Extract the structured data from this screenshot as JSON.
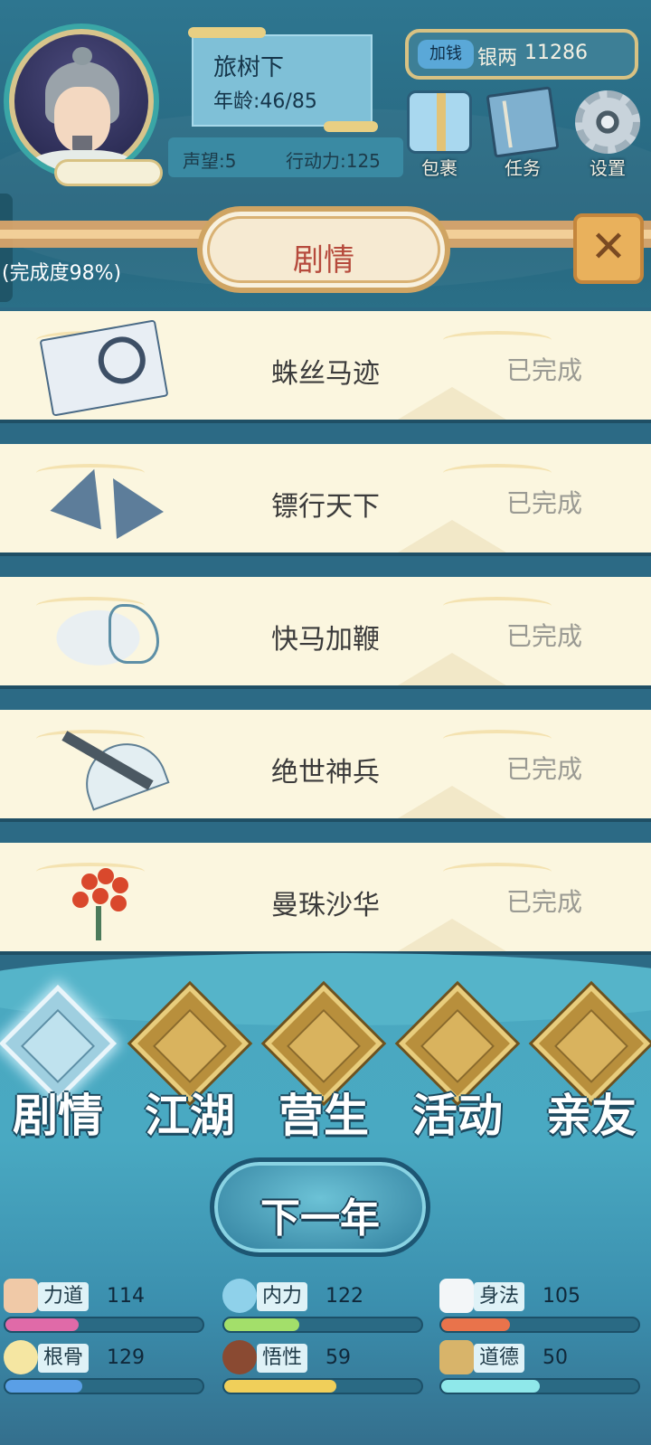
{
  "player": {
    "name": "旅树下",
    "age": "年龄:46/85",
    "reputation": "声望:5",
    "action_points": "行动力:125"
  },
  "money": {
    "add_button": "加钱",
    "label": "银两",
    "amount": "11286"
  },
  "top_buttons": {
    "bag": "包裹",
    "quest": "任务",
    "settings": "设置"
  },
  "panel": {
    "title": "剧情",
    "completion": "(完成度98%)",
    "close_symbol": "✕"
  },
  "story_items": [
    {
      "title": "蛛丝马迹",
      "status": "已完成",
      "icon": "letter-magnifier-icon"
    },
    {
      "title": "镖行天下",
      "status": "已完成",
      "icon": "shuriken-icon"
    },
    {
      "title": "快马加鞭",
      "status": "已完成",
      "icon": "horse-icon"
    },
    {
      "title": "绝世神兵",
      "status": "已完成",
      "icon": "sword-fan-icon"
    },
    {
      "title": "曼珠沙华",
      "status": "已完成",
      "icon": "red-spider-lily-icon"
    }
  ],
  "nav_tabs": [
    {
      "label": "剧情",
      "icon": "story-icon",
      "active": true
    },
    {
      "label": "江湖",
      "icon": "jianghu-hat-icon",
      "active": false
    },
    {
      "label": "营生",
      "icon": "abacus-icon",
      "active": false
    },
    {
      "label": "活动",
      "icon": "scroll-icon",
      "active": false
    },
    {
      "label": "亲友",
      "icon": "friends-icon",
      "active": false
    }
  ],
  "next_year_button": "下一年",
  "attributes": [
    {
      "name": "力道",
      "value": "114",
      "icon": "arm-strength-icon",
      "color": "#e06aa8",
      "fill": 0.37
    },
    {
      "name": "内力",
      "value": "122",
      "icon": "inner-energy-icon",
      "color": "#a3df6a",
      "fill": 0.38
    },
    {
      "name": "身法",
      "value": "105",
      "icon": "swallow-agility-icon",
      "color": "#e9734b",
      "fill": 0.35
    },
    {
      "name": "根骨",
      "value": "129",
      "icon": "root-bone-icon",
      "color": "#5a9fe6",
      "fill": 0.39
    },
    {
      "name": "悟性",
      "value": "59",
      "icon": "comprehension-icon",
      "color": "#f0cf5a",
      "fill": 0.57
    },
    {
      "name": "道德",
      "value": "50",
      "icon": "morality-book-icon",
      "color": "#8fe8ea",
      "fill": 0.5
    }
  ]
}
